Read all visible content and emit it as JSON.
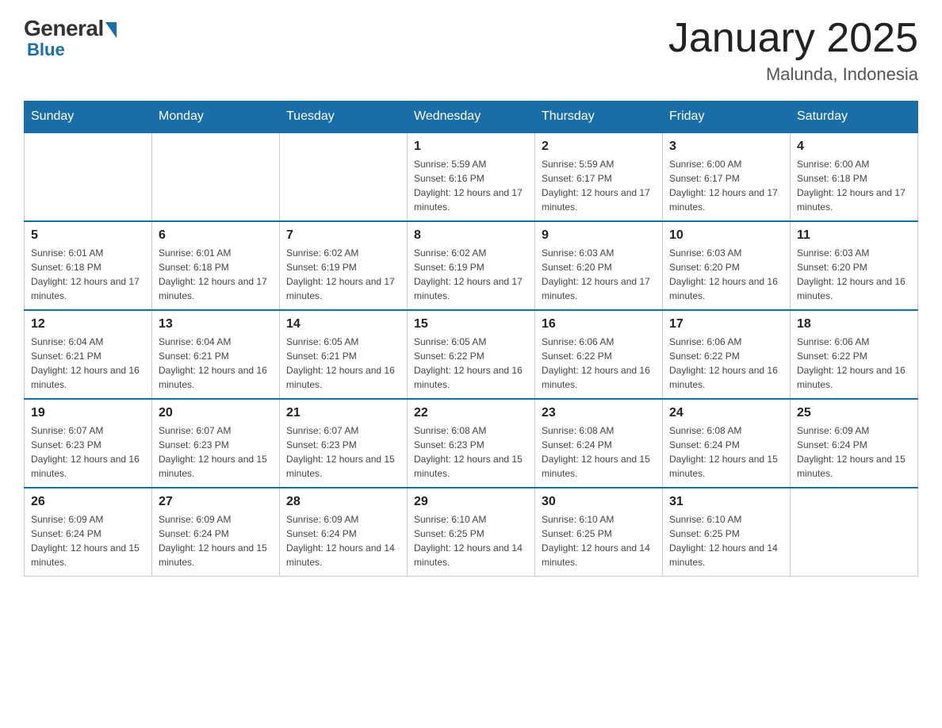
{
  "header": {
    "logo": {
      "general": "General",
      "blue": "Blue"
    },
    "title": "January 2025",
    "location": "Malunda, Indonesia"
  },
  "weekdays": [
    "Sunday",
    "Monday",
    "Tuesday",
    "Wednesday",
    "Thursday",
    "Friday",
    "Saturday"
  ],
  "weeks": [
    [
      {
        "day": null
      },
      {
        "day": null
      },
      {
        "day": null
      },
      {
        "day": "1",
        "sunrise": "5:59 AM",
        "sunset": "6:16 PM",
        "daylight": "12 hours and 17 minutes."
      },
      {
        "day": "2",
        "sunrise": "5:59 AM",
        "sunset": "6:17 PM",
        "daylight": "12 hours and 17 minutes."
      },
      {
        "day": "3",
        "sunrise": "6:00 AM",
        "sunset": "6:17 PM",
        "daylight": "12 hours and 17 minutes."
      },
      {
        "day": "4",
        "sunrise": "6:00 AM",
        "sunset": "6:18 PM",
        "daylight": "12 hours and 17 minutes."
      }
    ],
    [
      {
        "day": "5",
        "sunrise": "6:01 AM",
        "sunset": "6:18 PM",
        "daylight": "12 hours and 17 minutes."
      },
      {
        "day": "6",
        "sunrise": "6:01 AM",
        "sunset": "6:18 PM",
        "daylight": "12 hours and 17 minutes."
      },
      {
        "day": "7",
        "sunrise": "6:02 AM",
        "sunset": "6:19 PM",
        "daylight": "12 hours and 17 minutes."
      },
      {
        "day": "8",
        "sunrise": "6:02 AM",
        "sunset": "6:19 PM",
        "daylight": "12 hours and 17 minutes."
      },
      {
        "day": "9",
        "sunrise": "6:03 AM",
        "sunset": "6:20 PM",
        "daylight": "12 hours and 17 minutes."
      },
      {
        "day": "10",
        "sunrise": "6:03 AM",
        "sunset": "6:20 PM",
        "daylight": "12 hours and 16 minutes."
      },
      {
        "day": "11",
        "sunrise": "6:03 AM",
        "sunset": "6:20 PM",
        "daylight": "12 hours and 16 minutes."
      }
    ],
    [
      {
        "day": "12",
        "sunrise": "6:04 AM",
        "sunset": "6:21 PM",
        "daylight": "12 hours and 16 minutes."
      },
      {
        "day": "13",
        "sunrise": "6:04 AM",
        "sunset": "6:21 PM",
        "daylight": "12 hours and 16 minutes."
      },
      {
        "day": "14",
        "sunrise": "6:05 AM",
        "sunset": "6:21 PM",
        "daylight": "12 hours and 16 minutes."
      },
      {
        "day": "15",
        "sunrise": "6:05 AM",
        "sunset": "6:22 PM",
        "daylight": "12 hours and 16 minutes."
      },
      {
        "day": "16",
        "sunrise": "6:06 AM",
        "sunset": "6:22 PM",
        "daylight": "12 hours and 16 minutes."
      },
      {
        "day": "17",
        "sunrise": "6:06 AM",
        "sunset": "6:22 PM",
        "daylight": "12 hours and 16 minutes."
      },
      {
        "day": "18",
        "sunrise": "6:06 AM",
        "sunset": "6:22 PM",
        "daylight": "12 hours and 16 minutes."
      }
    ],
    [
      {
        "day": "19",
        "sunrise": "6:07 AM",
        "sunset": "6:23 PM",
        "daylight": "12 hours and 16 minutes."
      },
      {
        "day": "20",
        "sunrise": "6:07 AM",
        "sunset": "6:23 PM",
        "daylight": "12 hours and 15 minutes."
      },
      {
        "day": "21",
        "sunrise": "6:07 AM",
        "sunset": "6:23 PM",
        "daylight": "12 hours and 15 minutes."
      },
      {
        "day": "22",
        "sunrise": "6:08 AM",
        "sunset": "6:23 PM",
        "daylight": "12 hours and 15 minutes."
      },
      {
        "day": "23",
        "sunrise": "6:08 AM",
        "sunset": "6:24 PM",
        "daylight": "12 hours and 15 minutes."
      },
      {
        "day": "24",
        "sunrise": "6:08 AM",
        "sunset": "6:24 PM",
        "daylight": "12 hours and 15 minutes."
      },
      {
        "day": "25",
        "sunrise": "6:09 AM",
        "sunset": "6:24 PM",
        "daylight": "12 hours and 15 minutes."
      }
    ],
    [
      {
        "day": "26",
        "sunrise": "6:09 AM",
        "sunset": "6:24 PM",
        "daylight": "12 hours and 15 minutes."
      },
      {
        "day": "27",
        "sunrise": "6:09 AM",
        "sunset": "6:24 PM",
        "daylight": "12 hours and 15 minutes."
      },
      {
        "day": "28",
        "sunrise": "6:09 AM",
        "sunset": "6:24 PM",
        "daylight": "12 hours and 14 minutes."
      },
      {
        "day": "29",
        "sunrise": "6:10 AM",
        "sunset": "6:25 PM",
        "daylight": "12 hours and 14 minutes."
      },
      {
        "day": "30",
        "sunrise": "6:10 AM",
        "sunset": "6:25 PM",
        "daylight": "12 hours and 14 minutes."
      },
      {
        "day": "31",
        "sunrise": "6:10 AM",
        "sunset": "6:25 PM",
        "daylight": "12 hours and 14 minutes."
      },
      {
        "day": null
      }
    ]
  ]
}
